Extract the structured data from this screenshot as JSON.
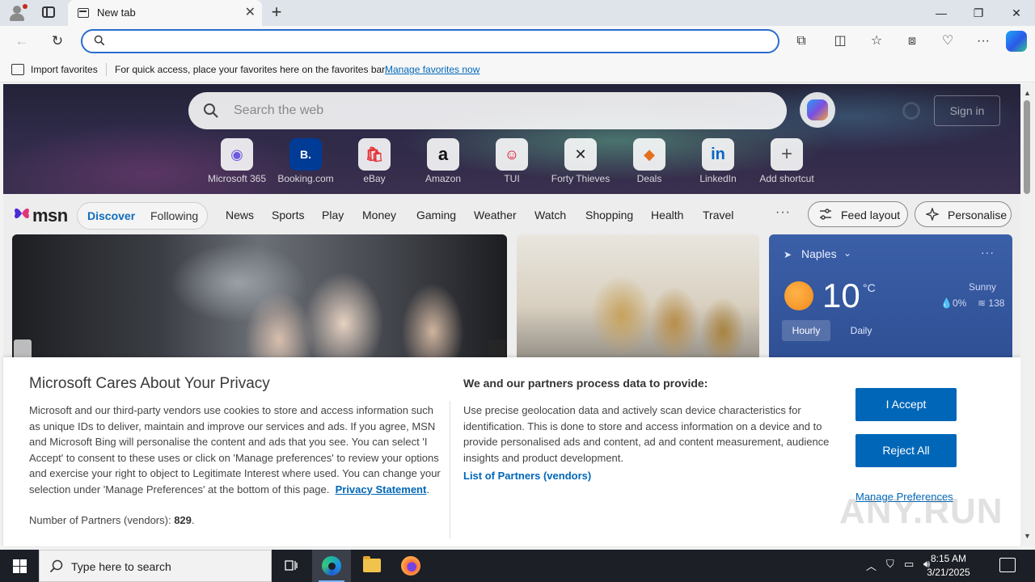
{
  "browser": {
    "tab_title": "New tab",
    "close_tab": "✕",
    "new_tab": "+",
    "minimize": "—",
    "restore": "❐",
    "close_window": "✕",
    "address_value": "",
    "favorites_bar": {
      "import_label": "Import favorites",
      "hint": "For quick access, place your favorites here on the favorites bar.",
      "manage_link": "Manage favorites now"
    },
    "toolbar_icons": [
      "back-icon",
      "reload-icon",
      "extensions-icon",
      "split-screen-icon",
      "favorites-icon",
      "collections-icon",
      "performance-icon",
      "more-icon",
      "copilot-icon"
    ]
  },
  "ntp": {
    "search_placeholder": "Search the web",
    "sign_in": "Sign in",
    "shortcuts": [
      {
        "label": "Microsoft 365",
        "glyph": "◉"
      },
      {
        "label": "Booking.com",
        "glyph": "B."
      },
      {
        "label": "eBay",
        "glyph": "🛍"
      },
      {
        "label": "Amazon",
        "glyph": "a"
      },
      {
        "label": "TUI",
        "glyph": "☺"
      },
      {
        "label": "Forty Thieves",
        "glyph": "✕"
      },
      {
        "label": "Deals",
        "glyph": "◆"
      },
      {
        "label": "LinkedIn",
        "glyph": "in"
      },
      {
        "label": "Add shortcut",
        "glyph": "+"
      }
    ],
    "msn": {
      "logo": "msn",
      "discover": "Discover",
      "following": "Following",
      "nav": [
        "News",
        "Sports",
        "Play",
        "Money",
        "Gaming",
        "Weather",
        "Watch",
        "Shopping",
        "Health",
        "Travel"
      ],
      "more": "···",
      "feed_layout": "Feed layout",
      "personalise": "Personalise"
    },
    "weather": {
      "city": "Naples",
      "temp": "10",
      "unit": "°C",
      "condition": "Sunny",
      "rain": "0%",
      "aqi": "138",
      "tab_hourly": "Hourly",
      "tab_daily": "Daily",
      "more": "···"
    }
  },
  "privacy": {
    "title": "Microsoft Cares About Your Privacy",
    "body": "Microsoft and our third-party vendors use cookies to store and access information such as unique IDs to deliver, maintain and improve our services and ads. If you agree, MSN and Microsoft Bing will personalise the content and ads that you see. You can select 'I Accept' to consent to these uses or click on 'Manage preferences' to review your options and exercise your right to object to Legitimate Interest where used.  You can change your selection under 'Manage Preferences' at the bottom of this page.",
    "statement_link": "Privacy Statement",
    "partners_label": "Number of Partners (vendors):",
    "partners_count": "829",
    "purpose_title": "We and our partners process data to provide:",
    "purpose_body": "Use precise geolocation data and actively scan device characteristics for identification. This is done to store and access information on a device and to provide personalised ads and content, ad and content measurement, audience insights and product development.",
    "list_link": "List of Partners (vendors)",
    "accept": "I Accept",
    "reject": "Reject All",
    "manage": "Manage Preferences",
    "watermark": "ANY.RUN"
  },
  "taskbar": {
    "search_placeholder": "Type here to search",
    "time": "8:15 AM",
    "date": "3/21/2025",
    "apps": [
      "task-view-icon",
      "edge-icon",
      "file-explorer-icon",
      "firefox-icon"
    ]
  }
}
